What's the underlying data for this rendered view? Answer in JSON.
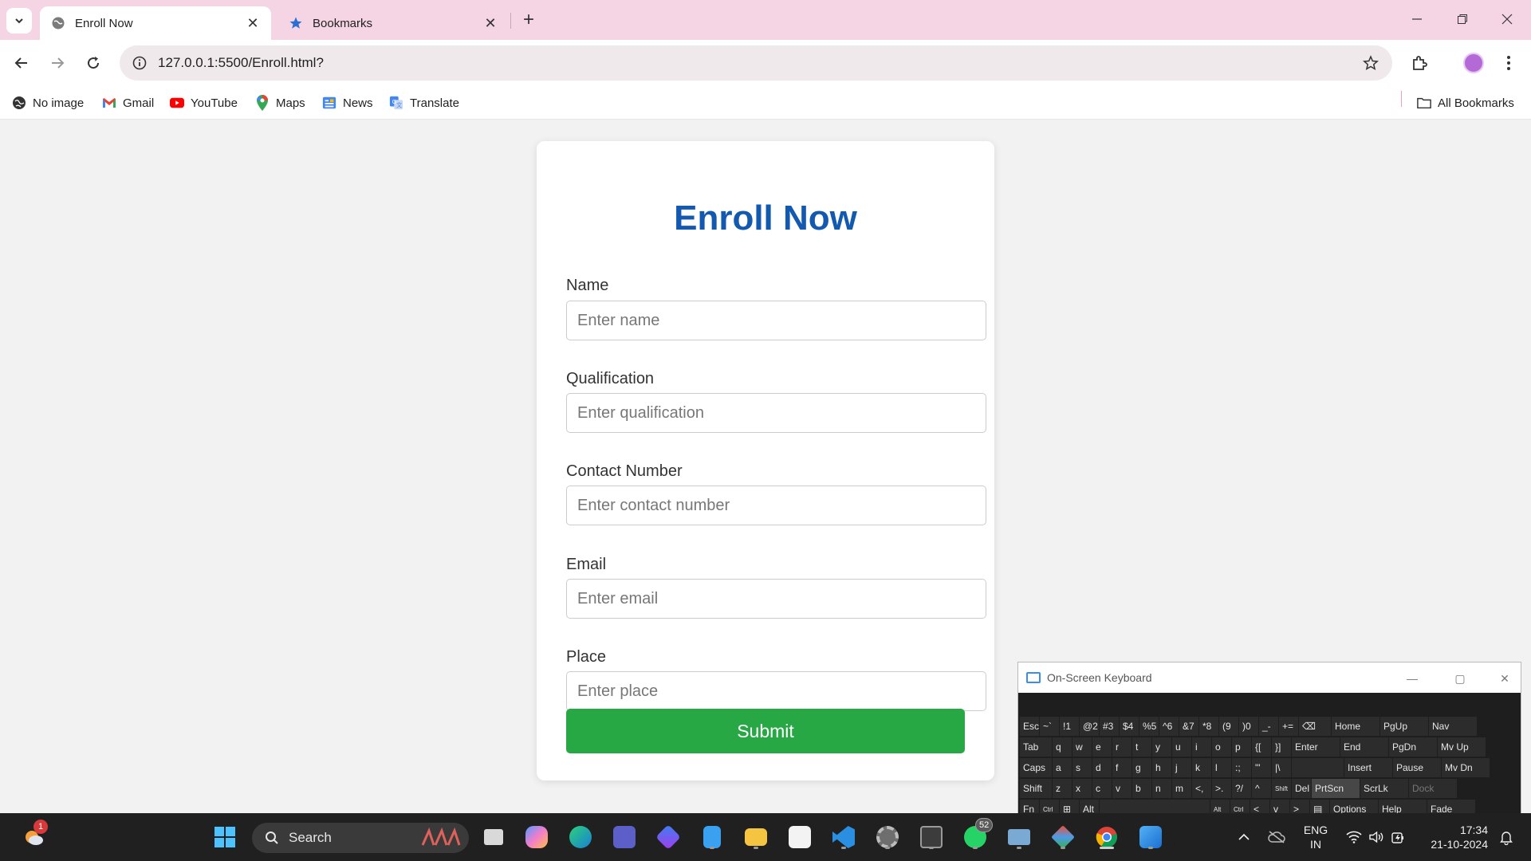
{
  "browser": {
    "tabs": [
      {
        "title": "Enroll Now",
        "active": true
      },
      {
        "title": "Bookmarks",
        "active": false
      }
    ],
    "url": "127.0.0.1:5500/Enroll.html?",
    "bookmarks": [
      {
        "label": "No image",
        "icon": "globe-icon"
      },
      {
        "label": "Gmail",
        "icon": "gmail-icon"
      },
      {
        "label": "YouTube",
        "icon": "youtube-icon"
      },
      {
        "label": "Maps",
        "icon": "maps-icon"
      },
      {
        "label": "News",
        "icon": "news-icon"
      },
      {
        "label": "Translate",
        "icon": "translate-icon"
      }
    ],
    "all_bookmarks": "All Bookmarks"
  },
  "form": {
    "heading": "Enroll Now",
    "fields": [
      {
        "label": "Name",
        "placeholder": "Enter name"
      },
      {
        "label": "Qualification",
        "placeholder": "Enter qualification"
      },
      {
        "label": "Contact Number",
        "placeholder": "Enter contact number"
      },
      {
        "label": "Email",
        "placeholder": "Enter email"
      },
      {
        "label": "Place",
        "placeholder": "Enter place"
      }
    ],
    "submit": "Submit",
    "colors": {
      "heading": "#1359b0",
      "submit": "#28a745"
    }
  },
  "osk": {
    "title": "On-Screen Keyboard",
    "rows": [
      [
        "Esc",
        "~`",
        "!1",
        "@2",
        "#3",
        "$4",
        "%5",
        "^6",
        "&7",
        "*8",
        "(9",
        ")0",
        "_-",
        "+=",
        "⌫",
        "Home",
        "PgUp",
        "Nav"
      ],
      [
        "Tab",
        "q",
        "w",
        "e",
        "r",
        "t",
        "y",
        "u",
        "i",
        "o",
        "p",
        "{[",
        "}]",
        "Enter",
        "End",
        "PgDn",
        "Mv Up"
      ],
      [
        "Caps",
        "a",
        "s",
        "d",
        "f",
        "g",
        "h",
        "j",
        "k",
        "l",
        ":;",
        "\"'",
        "|\\",
        "Insert",
        "Pause",
        "Mv Dn"
      ],
      [
        "Shift",
        "z",
        "x",
        "c",
        "v",
        "b",
        "n",
        "m",
        "<,",
        ">.",
        "?/",
        "^",
        "Shift",
        "Del",
        "PrtScn",
        "ScrLk",
        "Dock"
      ],
      [
        "Fn",
        "Ctrl",
        "⊞",
        "Alt",
        "",
        "Alt",
        "Ctrl",
        "<",
        "v",
        ">",
        "▤",
        "Options",
        "Help",
        "Fade"
      ]
    ]
  },
  "taskbar": {
    "search_label": "Search",
    "widgets_badge": "1",
    "whatsapp_badge": "52",
    "language": "ENG",
    "region": "IN",
    "time": "17:34",
    "date": "21-10-2024"
  }
}
